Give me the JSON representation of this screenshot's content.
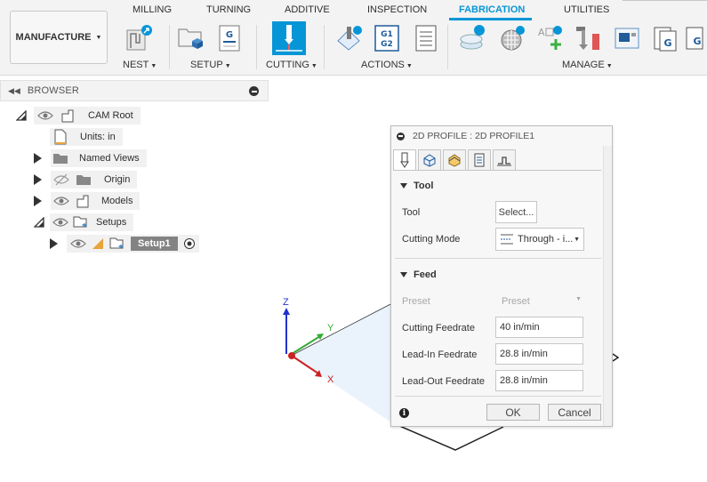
{
  "toolbar": {
    "workspace_label": "MANUFACTURE",
    "tabs": [
      "MILLING",
      "TURNING",
      "ADDITIVE",
      "INSPECTION",
      "FABRICATION",
      "UTILITIES"
    ],
    "active_tab": "FABRICATION",
    "groups": {
      "nest": "NEST",
      "setup": "SETUP",
      "cutting": "CUTTING",
      "actions": "ACTIONS",
      "manage": "MANAGE"
    },
    "gcode_icon_text": "G1\nG2",
    "setup_icon_text": "G",
    "accent": "#0696d7"
  },
  "browser": {
    "title": "BROWSER",
    "nodes": {
      "cam_root": "CAM Root",
      "units": "Units: in",
      "named_views": "Named Views",
      "origin": "Origin",
      "models": "Models",
      "setups": "Setups",
      "setup1": "Setup1"
    }
  },
  "viewport": {
    "axis_z": "Z",
    "axis_y": "Y",
    "axis_x": "X"
  },
  "dialog": {
    "title": "2D PROFILE : 2D PROFILE1",
    "tool_section": {
      "header": "Tool",
      "tool_label": "Tool",
      "tool_button": "Select...",
      "cutting_mode_label": "Cutting Mode",
      "cutting_mode_value": "Through - i..."
    },
    "feed_section": {
      "header": "Feed",
      "preset_label": "Preset",
      "preset_value": "Preset",
      "cutting_feedrate_label": "Cutting Feedrate",
      "cutting_feedrate_value": "40 in/min",
      "lead_in_label": "Lead-In Feedrate",
      "lead_in_value": "28.8 in/min",
      "lead_out_label": "Lead-Out Feedrate",
      "lead_out_value": "28.8 in/min"
    },
    "ok_label": "OK",
    "cancel_label": "Cancel"
  }
}
